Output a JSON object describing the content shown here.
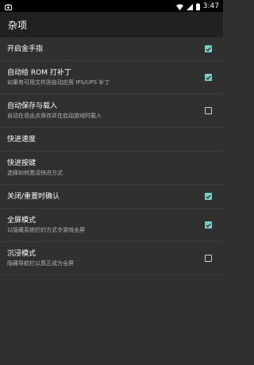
{
  "status": {
    "time": "3:47"
  },
  "app": {
    "title": "杂项"
  },
  "colors": {
    "accent": "#80cbc4",
    "background": "#303030",
    "app_bar": "#212121"
  },
  "settings": [
    {
      "title": "开启金手指",
      "subtitle": "",
      "checkbox": true,
      "checked": true
    },
    {
      "title": "自动给 ROM 打补丁",
      "subtitle": "如果有可用文件则自动应用 IPS/UPS 补丁",
      "checkbox": true,
      "checked": true
    },
    {
      "title": "自动保存与载入",
      "subtitle": "自动在退出点保存并在启动游戏时载入",
      "checkbox": true,
      "checked": false
    },
    {
      "title": "快进速度",
      "subtitle": "",
      "checkbox": false,
      "checked": false
    },
    {
      "title": "快进按键",
      "subtitle": "选择如何激活快进方式",
      "checkbox": false,
      "checked": false
    },
    {
      "title": "关闭/重置时确认",
      "subtitle": "",
      "checkbox": true,
      "checked": true
    },
    {
      "title": "全屏模式",
      "subtitle": "以隐藏系统栏的方式令游戏全屏",
      "checkbox": true,
      "checked": true
    },
    {
      "title": "沉浸模式",
      "subtitle": "隐藏导航栏以真正成为全屏",
      "checkbox": true,
      "checked": false
    }
  ]
}
